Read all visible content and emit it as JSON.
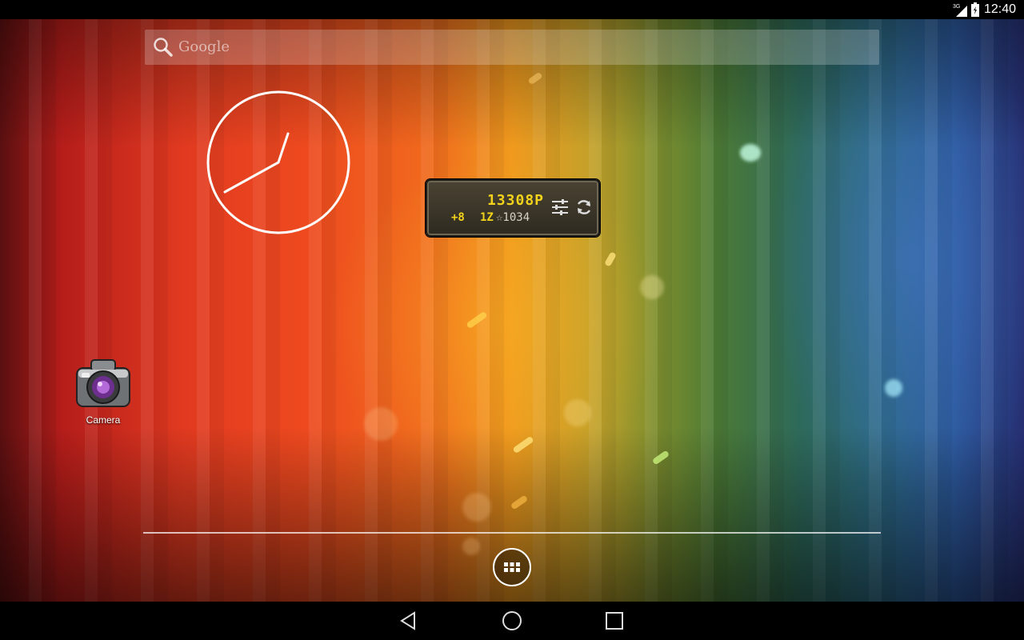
{
  "status_bar": {
    "network_type": "3G",
    "time": "12:40",
    "icons": [
      "signal-icon",
      "battery-icon"
    ]
  },
  "search": {
    "label": "Google",
    "icon": "search-icon"
  },
  "clock_widget": {
    "type": "analog-clock",
    "hour": 12,
    "minute": 40
  },
  "game_widget": {
    "points": "13308P",
    "gain": "+8",
    "level": "1Z",
    "stars": "☆1034",
    "icons": [
      "settings-sliders-icon",
      "refresh-icon"
    ]
  },
  "desktop": {
    "shortcuts": [
      {
        "label": "Camera",
        "icon": "camera-icon"
      }
    ]
  },
  "dock": {
    "all_apps_icon": "all-apps-grid-icon"
  },
  "nav_bar": {
    "buttons": [
      "back-icon",
      "home-icon",
      "recent-apps-icon"
    ]
  }
}
